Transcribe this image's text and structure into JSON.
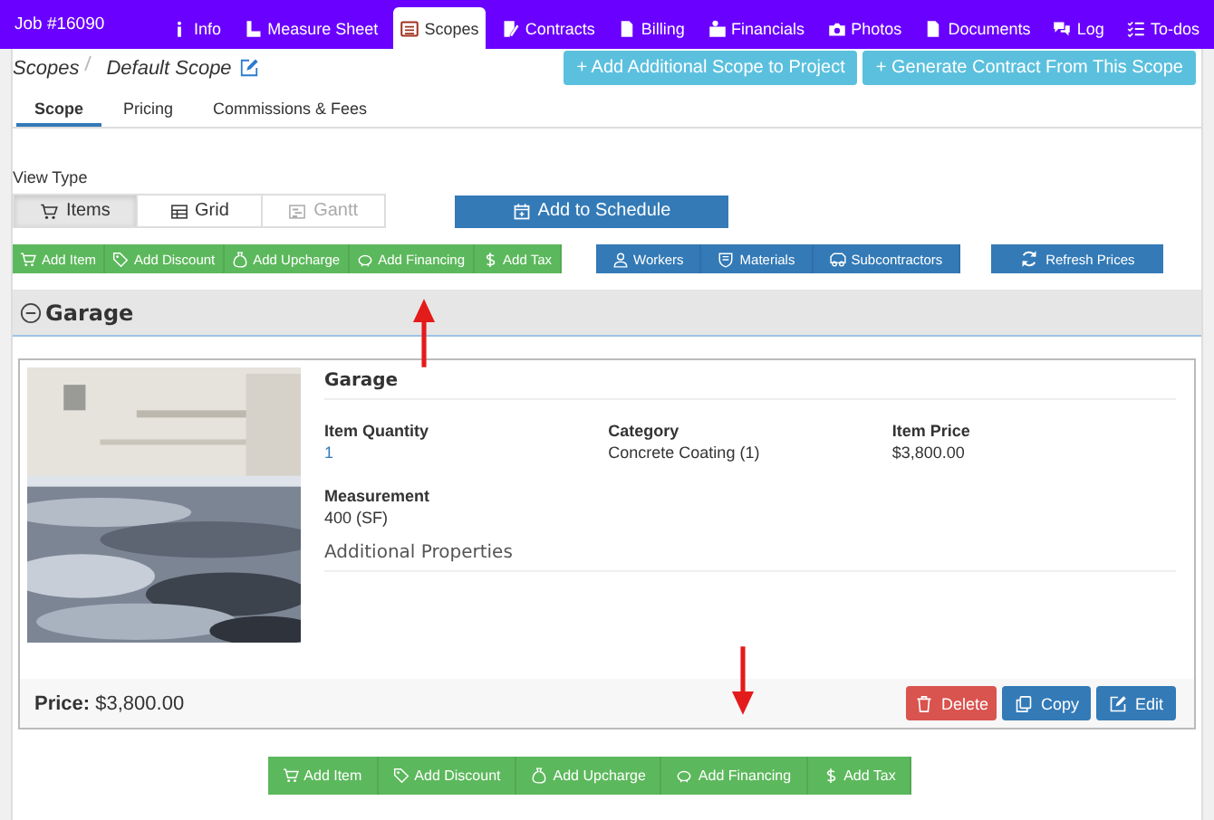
{
  "nav": {
    "job": "Job #16090",
    "tabs": [
      {
        "label": "Info",
        "selected": false
      },
      {
        "label": "Measure Sheet",
        "selected": false
      },
      {
        "label": "Scopes",
        "selected": true
      },
      {
        "label": "Contracts",
        "selected": false
      },
      {
        "label": "Billing",
        "selected": false
      },
      {
        "label": "Financials",
        "selected": false
      },
      {
        "label": "Photos",
        "selected": false
      },
      {
        "label": "Documents",
        "selected": false
      },
      {
        "label": "Log",
        "selected": false
      },
      {
        "label": "To-dos",
        "selected": false
      }
    ]
  },
  "breadcrumb": {
    "parent": "Scopes",
    "current": "Default Scope"
  },
  "header_actions": [
    "+ Add Additional Scope to Project",
    "+ Generate Contract From This Scope"
  ],
  "subtabs": [
    {
      "label": "Scope",
      "selected": true
    },
    {
      "label": "Pricing",
      "selected": false
    },
    {
      "label": "Commissions & Fees",
      "selected": false
    }
  ],
  "view_type": {
    "label": "View Type",
    "options": [
      {
        "label": "Items",
        "selected": true,
        "disabled": false
      },
      {
        "label": "Grid",
        "selected": false,
        "disabled": false
      },
      {
        "label": "Gantt",
        "selected": false,
        "disabled": true
      }
    ]
  },
  "schedule_button": {
    "label": "Add to Schedule"
  },
  "item_actions": [
    {
      "label": "Add Item"
    },
    {
      "label": "Add Discount"
    },
    {
      "label": "Add Upcharge"
    },
    {
      "label": "Add Financing"
    },
    {
      "label": "Add Tax"
    }
  ],
  "resource_actions": [
    {
      "label": "Workers"
    },
    {
      "label": "Materials"
    },
    {
      "label": "Subcontractors"
    }
  ],
  "refresh_button": {
    "label": "Refresh Prices"
  },
  "section": {
    "title": "Garage",
    "expanded": true
  },
  "item": {
    "title": "Garage",
    "fields": [
      {
        "label": "Item Quantity",
        "value": "1",
        "link": true
      },
      {
        "label": "Category",
        "value": "Concrete Coating (1)",
        "link": false
      },
      {
        "label": "Item Price",
        "value": "$3,800.00",
        "link": false
      },
      {
        "label": "Measurement",
        "value": "400 (SF)",
        "link": false
      }
    ],
    "additional": "Additional Properties",
    "price_label": "Price:",
    "price": "$3,800.00",
    "actions": [
      {
        "label": "Delete",
        "kind": "danger"
      },
      {
        "label": "Copy",
        "kind": "primary"
      },
      {
        "label": "Edit",
        "kind": "primary"
      }
    ]
  },
  "bottom_actions": [
    {
      "label": "Add Item"
    },
    {
      "label": "Add Discount"
    },
    {
      "label": "Add Upcharge"
    },
    {
      "label": "Add Financing"
    },
    {
      "label": "Add Tax"
    }
  ]
}
